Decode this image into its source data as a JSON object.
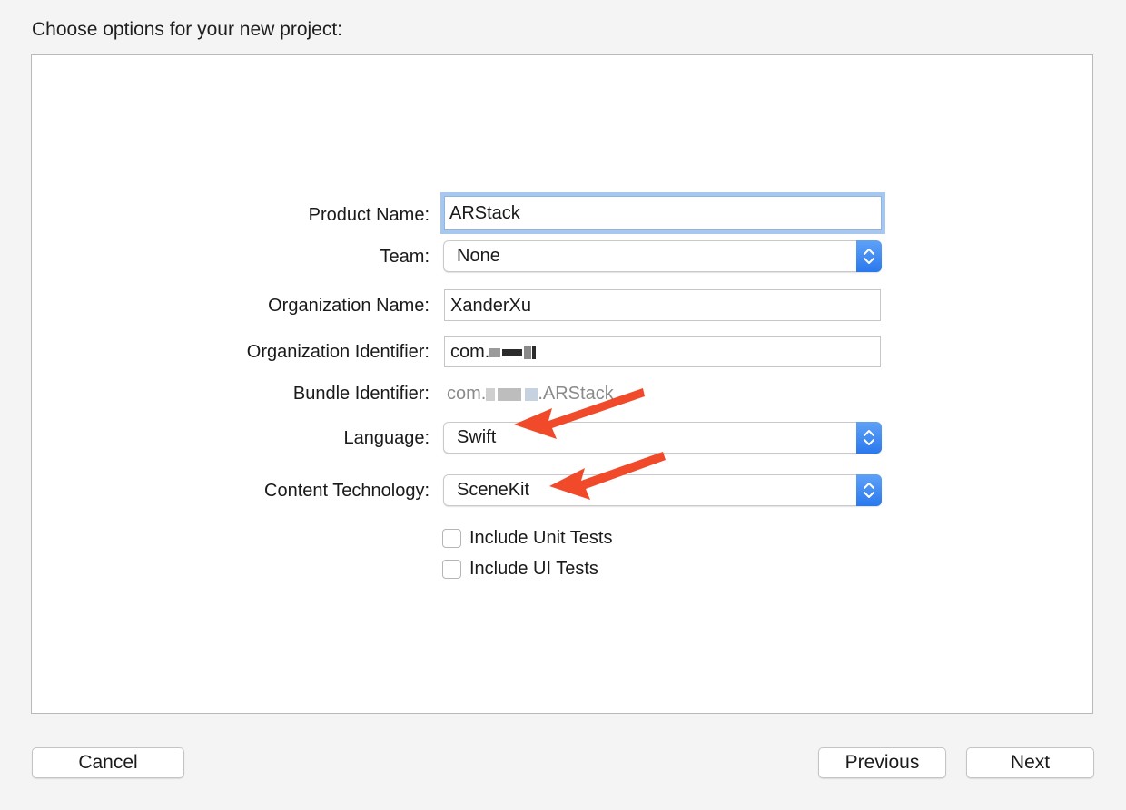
{
  "dialog": {
    "heading": "Choose options for your new project:"
  },
  "form": {
    "product_name": {
      "label": "Product Name:",
      "value": "ARStack"
    },
    "team": {
      "label": "Team:",
      "value": "None"
    },
    "organization_name": {
      "label": "Organization Name:",
      "value": "XanderXu"
    },
    "organization_identifier": {
      "label": "Organization Identifier:",
      "value_prefix": "com."
    },
    "bundle_identifier": {
      "label": "Bundle Identifier:",
      "value_prefix": "com.",
      "value_suffix": ".ARStack"
    },
    "language": {
      "label": "Language:",
      "value": "Swift"
    },
    "content_technology": {
      "label": "Content Technology:",
      "value": "SceneKit"
    },
    "include_unit_tests": {
      "label": "Include Unit Tests",
      "checked": false
    },
    "include_ui_tests": {
      "label": "Include UI Tests",
      "checked": false
    }
  },
  "buttons": {
    "cancel": "Cancel",
    "previous": "Previous",
    "next": "Next"
  },
  "colors": {
    "accent_stepper": "#2a78ee",
    "annotation_arrow": "#f04a2a",
    "focus_ring": "#a6c8ef"
  },
  "icons": [
    "chevron-updown-icon",
    "annotation-arrow"
  ]
}
